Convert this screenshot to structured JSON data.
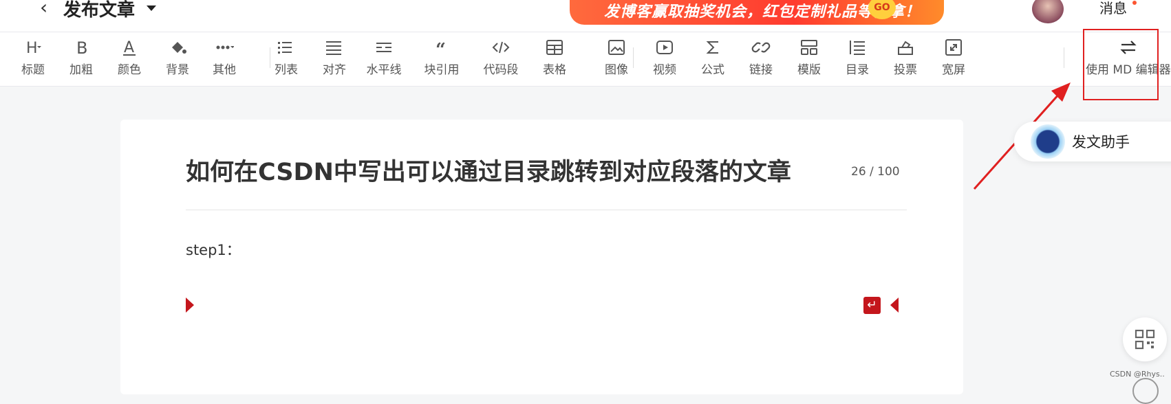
{
  "header": {
    "back_glyph": "‹",
    "title": "发布文章",
    "banner_text": "发博客赢取抽奖机会，红包定制礼品等你拿！",
    "banner_badge": "GO",
    "messages_label": "消息"
  },
  "toolbar": {
    "items": [
      {
        "label": "标题",
        "icon": "heading-icon"
      },
      {
        "label": "加粗",
        "icon": "bold-icon"
      },
      {
        "label": "颜色",
        "icon": "text-color-icon"
      },
      {
        "label": "背景",
        "icon": "paint-bucket-icon"
      },
      {
        "label": "其他",
        "icon": "more-icon"
      },
      {
        "label": "列表",
        "icon": "list-icon"
      },
      {
        "label": "对齐",
        "icon": "align-icon"
      },
      {
        "label": "水平线",
        "icon": "horizontal-rule-icon"
      },
      {
        "label": "块引用",
        "icon": "blockquote-icon"
      },
      {
        "label": "代码段",
        "icon": "code-icon"
      },
      {
        "label": "表格",
        "icon": "table-icon"
      },
      {
        "label": "图像",
        "icon": "image-icon"
      },
      {
        "label": "视频",
        "icon": "video-icon"
      },
      {
        "label": "公式",
        "icon": "formula-icon"
      },
      {
        "label": "链接",
        "icon": "link-icon"
      },
      {
        "label": "模版",
        "icon": "template-icon"
      },
      {
        "label": "目录",
        "icon": "toc-icon"
      },
      {
        "label": "投票",
        "icon": "vote-icon"
      },
      {
        "label": "宽屏",
        "icon": "widescreen-icon"
      }
    ],
    "md_switch_label": "使用 MD 编辑器"
  },
  "editor": {
    "title": "如何在CSDN中写出可以通过目录跳转到对应段落的文章",
    "title_count": "26 / 100",
    "paragraph": "step1：",
    "enter_glyph": "↵"
  },
  "assistant": {
    "label": "发文助手"
  },
  "watermark": "CSDN @Rhys..",
  "colors": {
    "accent_red": "#c4161c",
    "annotation_red": "#e02020",
    "banner_orange": "#ff3b2f"
  }
}
